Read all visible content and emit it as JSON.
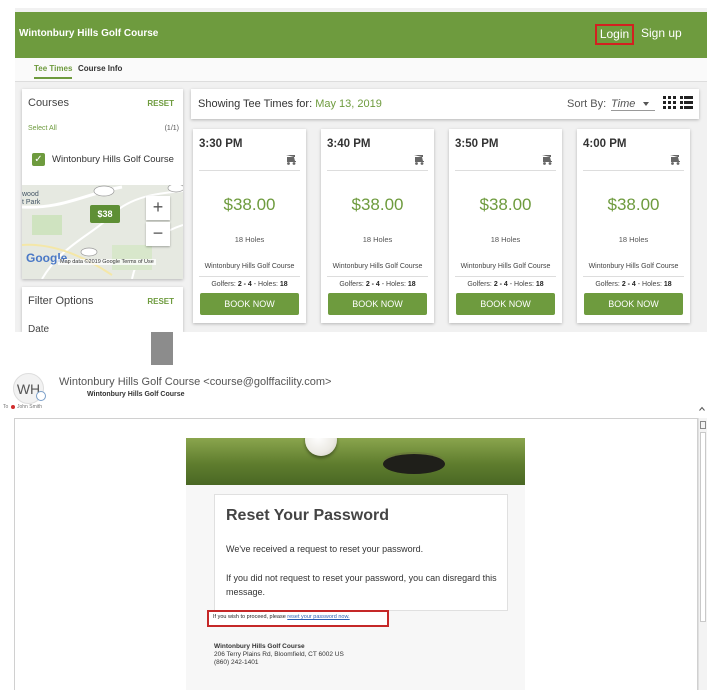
{
  "site": {
    "title": "Wintonbury Hills Golf Course",
    "login_label": "Login",
    "signup_label": "Sign up",
    "brand_color": "#6e9b3e"
  },
  "tabs": [
    {
      "label": "Tee Times",
      "active": true
    },
    {
      "label": "Course Info",
      "active": false
    }
  ],
  "courses": {
    "title": "Courses",
    "reset_label": "RESET",
    "select_all_label": "Select All",
    "count": "(1/1)",
    "items": [
      {
        "name": "Wintonbury Hills Golf Course",
        "checked": true
      }
    ]
  },
  "map": {
    "price_marker": "$38",
    "zoom_in": "+",
    "zoom_out": "−",
    "logo": "Google",
    "attribution": "Map data ©2019 Google   Terms of Use",
    "label_wood": "wood",
    "label_park": "t Park"
  },
  "filter": {
    "title": "Filter Options",
    "reset_label": "RESET",
    "date_label": "Date"
  },
  "results": {
    "prefix": "Showing Tee Times for:",
    "date": "May 13, 2019",
    "sort_label": "Sort By:",
    "sort_value": "Time"
  },
  "tee_times": [
    {
      "time": "3:30 PM",
      "price": "$38.00",
      "holes": "18 Holes",
      "course": "Wintonbury Hills Golf Course",
      "golfers_prefix": "Golfers:",
      "golfers": "2 - 4",
      "holes_prefix": " - Holes:",
      "holes_count": "18",
      "book_label": "BOOK NOW"
    },
    {
      "time": "3:40 PM",
      "price": "$38.00",
      "holes": "18 Holes",
      "course": "Wintonbury Hills Golf Course",
      "golfers_prefix": "Golfers:",
      "golfers": "2 - 4",
      "holes_prefix": " - Holes:",
      "holes_count": "18",
      "book_label": "BOOK NOW"
    },
    {
      "time": "3:50 PM",
      "price": "$38.00",
      "holes": "18 Holes",
      "course": "Wintonbury Hills Golf Course",
      "golfers_prefix": "Golfers:",
      "golfers": "2 - 4",
      "holes_prefix": " - Holes:",
      "holes_count": "18",
      "book_label": "BOOK NOW"
    },
    {
      "time": "4:00 PM",
      "price": "$38.00",
      "holes": "18 Holes",
      "course": "Wintonbury Hills Golf Course",
      "golfers_prefix": "Golfers:",
      "golfers": "2 - 4",
      "holes_prefix": " - Holes:",
      "holes_count": "18",
      "book_label": "BOOK NOW"
    }
  ],
  "email": {
    "avatar_initials": "WH",
    "sender": "Wintonbury Hills Golf Course <course@golffacility.com>",
    "sender_sub": "Wintonbury Hills Golf Course",
    "to_label": "To",
    "to_name": "John Smith",
    "heading": "Reset Your Password",
    "p1": "We've received a request to reset your password.",
    "p2": "If you did not request to reset your password, you can disregard this message.",
    "proceed_prefix": "If you wish to proceed, please ",
    "proceed_link": "reset your password now.",
    "footer_name": "Wintonbury Hills Golf Course",
    "footer_address": "206 Terry Plains Rd, Bloomfield, CT 6002 US",
    "footer_phone": "(860) 242-1401",
    "highlight_color": "#c52828"
  }
}
